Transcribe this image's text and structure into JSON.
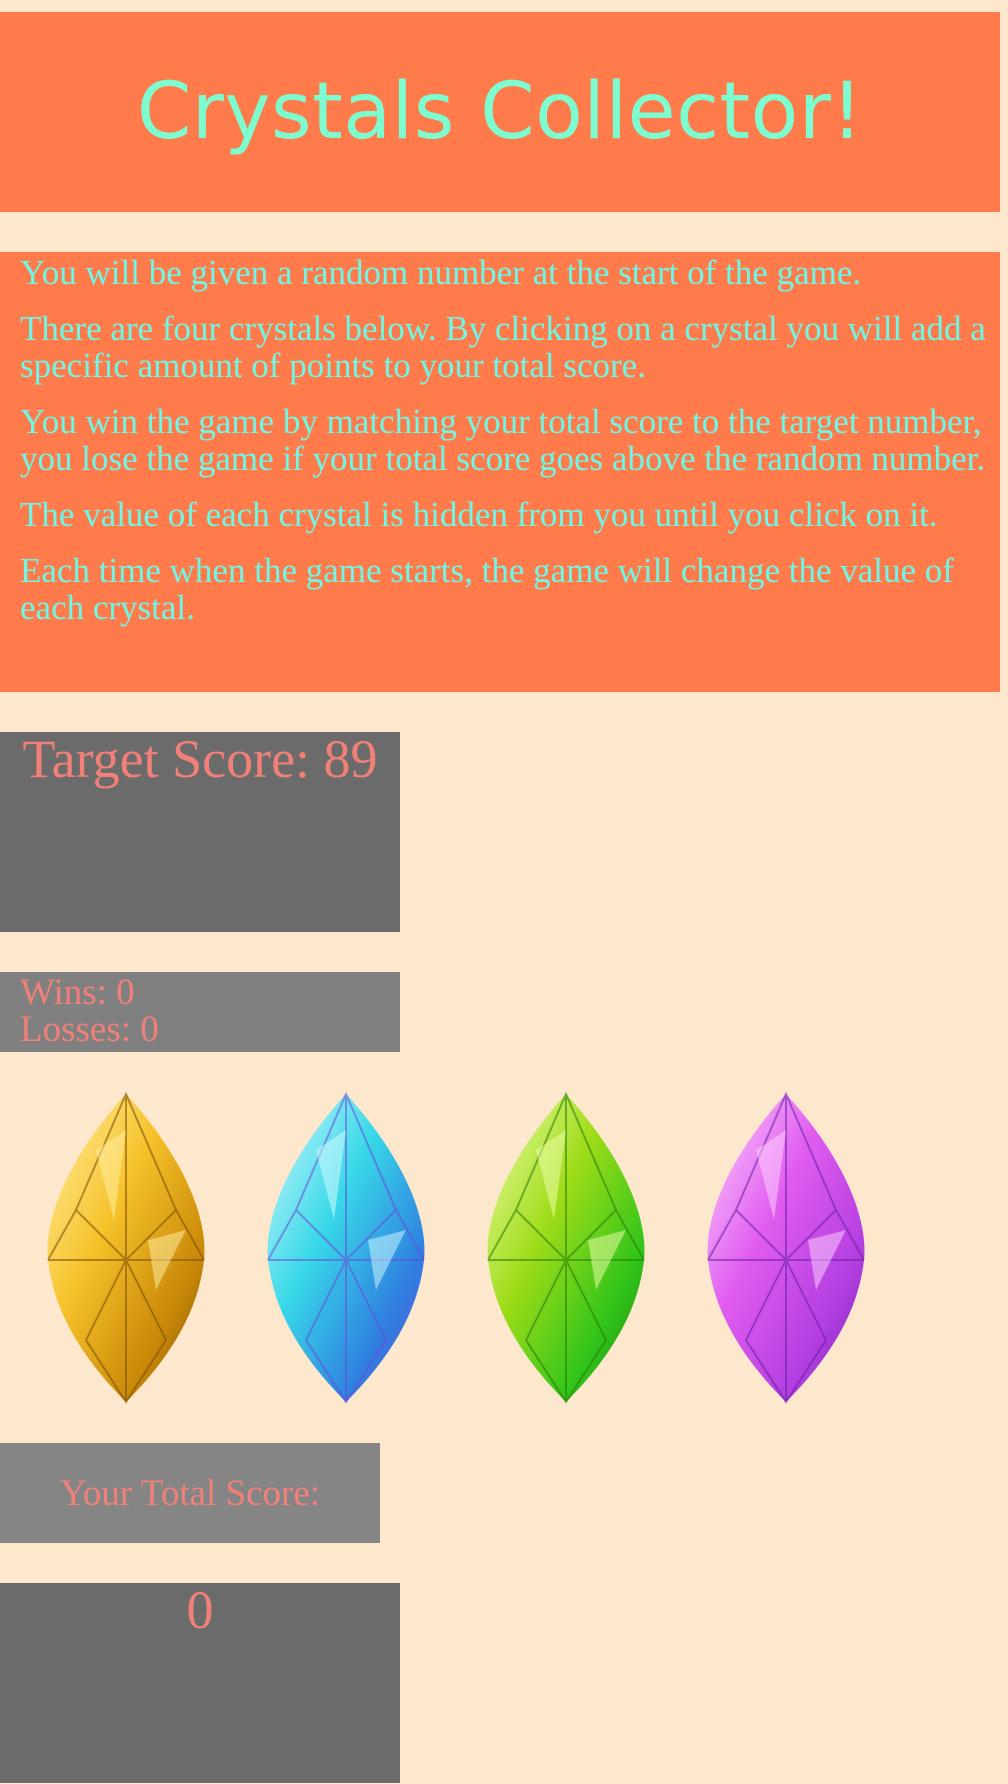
{
  "header": {
    "title": "Crystals Collector!"
  },
  "instructions": [
    "You will be given a random number at the start of the game.",
    "There are four crystals below. By clicking on a crystal you will add a specific amount of points to your total score.",
    "You win the game by matching your total score to the target number, you lose the game if your total score goes above the random number.",
    "The value of each crystal is hidden from you until you click on it.",
    "Each time when the game starts, the game will change the value of each crystal."
  ],
  "target": {
    "label": "Target Score: 89"
  },
  "stats": {
    "wins": "Wins: 0",
    "losses": "Losses: 0"
  },
  "crystals": [
    {
      "name": "yellow-crystal",
      "colors": [
        "#fff2a8",
        "#f6c22a",
        "#c98808",
        "#7a4a05"
      ]
    },
    {
      "name": "blue-crystal",
      "colors": [
        "#d8fbff",
        "#38d8e8",
        "#2f7fe0",
        "#6a4ad8"
      ]
    },
    {
      "name": "green-crystal",
      "colors": [
        "#f2ffb0",
        "#9fdc18",
        "#2fc41a",
        "#2a7a08"
      ]
    },
    {
      "name": "purple-crystal",
      "colors": [
        "#ffd6ff",
        "#e05cf0",
        "#b23ee0",
        "#6a1fa8"
      ]
    }
  ],
  "total": {
    "label": "Your Total Score:",
    "value": "0"
  },
  "colors": {
    "background": "#fde8cd",
    "panel_orange": "#ff7b4c",
    "title_teal": "#7dfcd0",
    "text_cyan": "#6df7e4",
    "score_salmon": "#f08078",
    "box_dark": "#6b6b6b",
    "box_mid": "#808080"
  }
}
